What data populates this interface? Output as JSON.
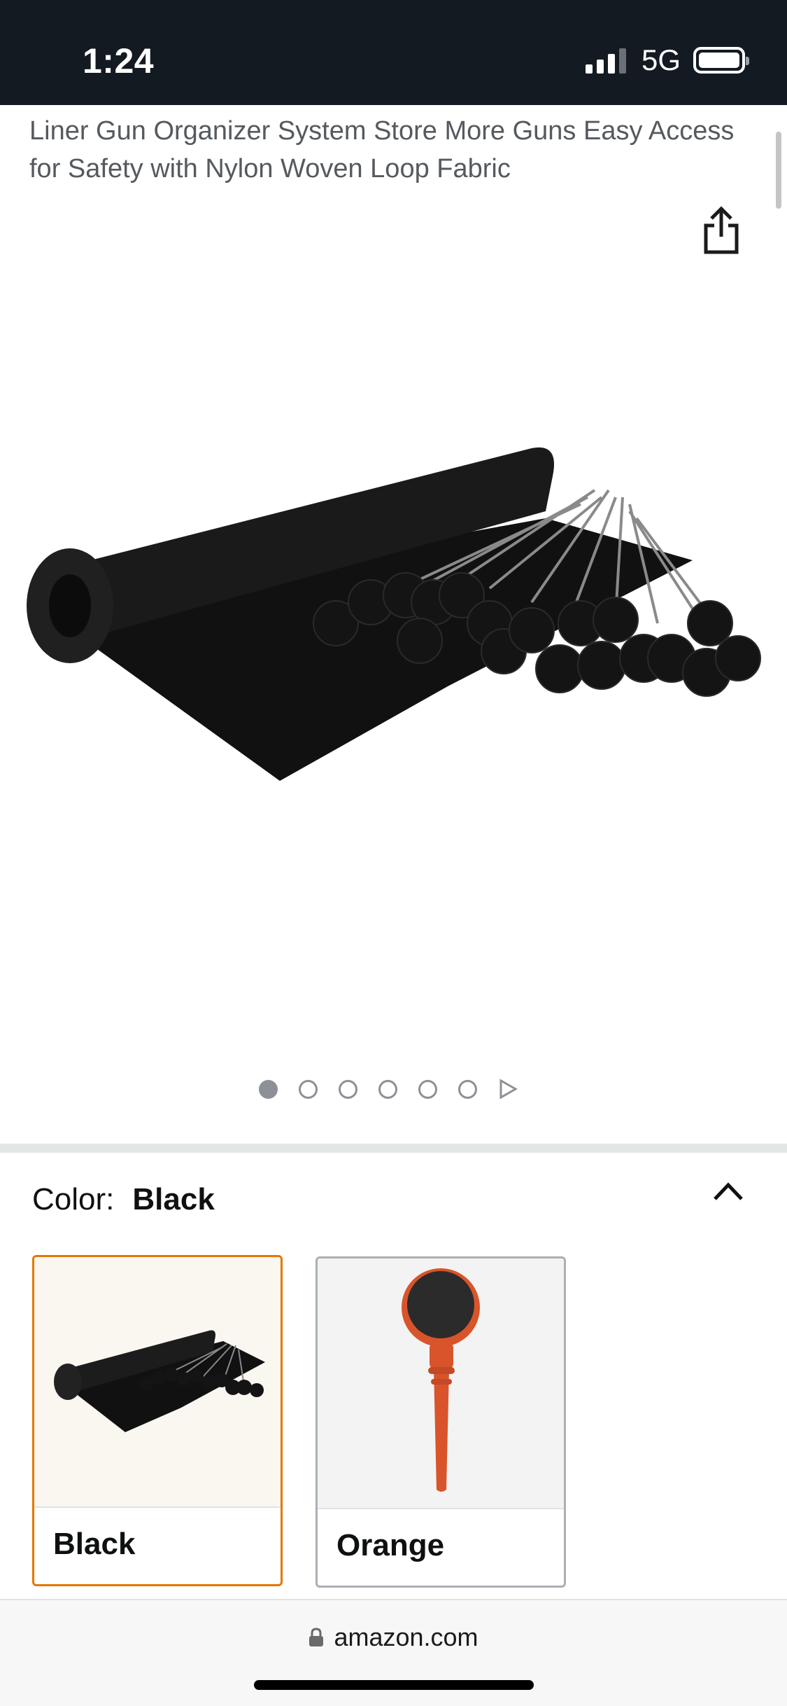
{
  "status_bar": {
    "time": "1:24",
    "network": "5G"
  },
  "product": {
    "title": "Liner Gun Organizer System Store More Guns Easy Access for Safety with Nylon Woven Loop Fabric",
    "image_count": 6,
    "active_image_index": 0
  },
  "variations": {
    "color_label": "Color:",
    "selected_color": "Black",
    "options": [
      {
        "label": "Black",
        "selected": true,
        "accent": "#e77600"
      },
      {
        "label": "Orange",
        "selected": false,
        "accent": "#aab0b4"
      }
    ]
  },
  "browser": {
    "url": "amazon.com"
  },
  "colors": {
    "status_bar_bg": "#131a22",
    "selected_border": "#e77600",
    "swatch_orange": "#d9542a"
  },
  "icons": {
    "share": "share-icon",
    "collapse": "chevron-up-icon",
    "lock": "lock-icon",
    "next": "play-icon"
  }
}
